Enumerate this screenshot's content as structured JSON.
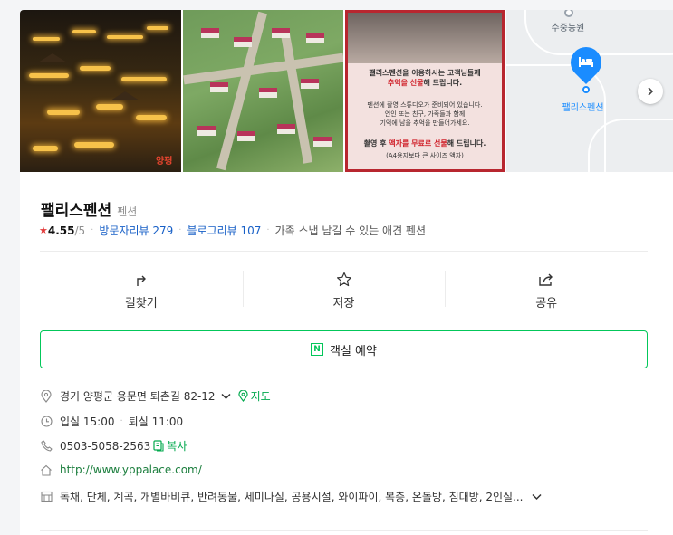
{
  "place": {
    "name": "팰리스펜션",
    "category": "펜션",
    "rating": "4.55",
    "rating_max": "/5",
    "visitor_reviews_label": "방문자리뷰",
    "visitor_reviews_count": "279",
    "blog_reviews_label": "블로그리뷰",
    "blog_reviews_count": "107",
    "description": "가족 스냅 남길 수 있는 애견 펜션"
  },
  "gallery": {
    "photo3_heading": "팰리스펜션을 이용하시는 고객님들께",
    "photo3_heading2_before": "",
    "photo3_heading2_red": "추억을 선물",
    "photo3_heading2_after": "해 드립니다.",
    "photo3_body1": "펜션에 촬영 스튜디오가 준비되어 있습니다.",
    "photo3_body2": "연인 또는 친구, 가족들과 함께",
    "photo3_body3": "기억에 남을 추억을 만들어가세요.",
    "photo3_footer_before": "촬영 후 ",
    "photo3_footer_red": "액자를 무료로 선물",
    "photo3_footer_after": "해 드립니다.",
    "photo3_note": "(A4용지보다 큰 사이즈 액자)",
    "photo1_sign": "양평",
    "map_poi": "수중농원",
    "map_pin_label": "팰리스펜션"
  },
  "actions": {
    "directions": "길찾기",
    "save": "저장",
    "share": "공유"
  },
  "booking": {
    "label": "객실 예약",
    "icon_letter": "N"
  },
  "info": {
    "address": "경기 양평군 용문면 퇴촌길 82-12",
    "map_link": "지도",
    "hours_checkin": "입실 15:00",
    "hours_checkout": "퇴실 11:00",
    "phone": "0503-5058-2563",
    "copy": "복사",
    "website": "http://www.yppalace.com/",
    "amenities": "독채, 단체, 계곡, 개별바비큐, 반려동물, 세미나실, 공용시설, 와이파이, 복층, 온돌방, 침대방, 2인실..."
  },
  "colors": {
    "naver_green": "#03c75a",
    "link_blue": "#1860c7",
    "star_red": "#e23b3b"
  }
}
